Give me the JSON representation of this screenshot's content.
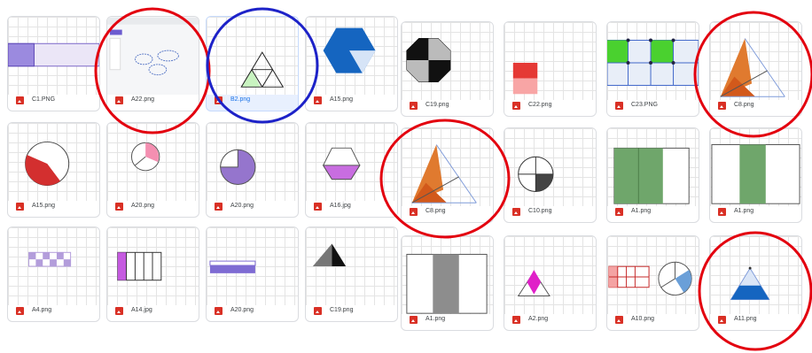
{
  "files": {
    "c1": "C1.PNG",
    "a22": "A22.png",
    "b2": "B2.png",
    "a15_top": "A15.png",
    "c19_top": "C19.png",
    "c22": "C22.png",
    "c23": "C23.PNG",
    "c8_top": "C8.png",
    "a15_mid": "A15.png",
    "a20_mid_1": "A20.png",
    "a20_mid_2": "A20.png",
    "a16": "A16.jpg",
    "c8_mid": "C8.png",
    "c10": "C10.png",
    "a1_mid_1": "A1.png",
    "a1_mid_2": "A1.png",
    "a4": "A4.png",
    "a14": "A14.jpg",
    "a20_bot": "A20.png",
    "c19_bot": "C19.png",
    "a1_bot": "A1.png",
    "a2": "A2.png",
    "a10": "A10.png",
    "a11": "A11.png"
  },
  "selected_file": "B2.png",
  "annotation_colors": {
    "red": "#e3000f",
    "blue": "#1d22c8"
  },
  "file_type_icon": "image-file-icon"
}
